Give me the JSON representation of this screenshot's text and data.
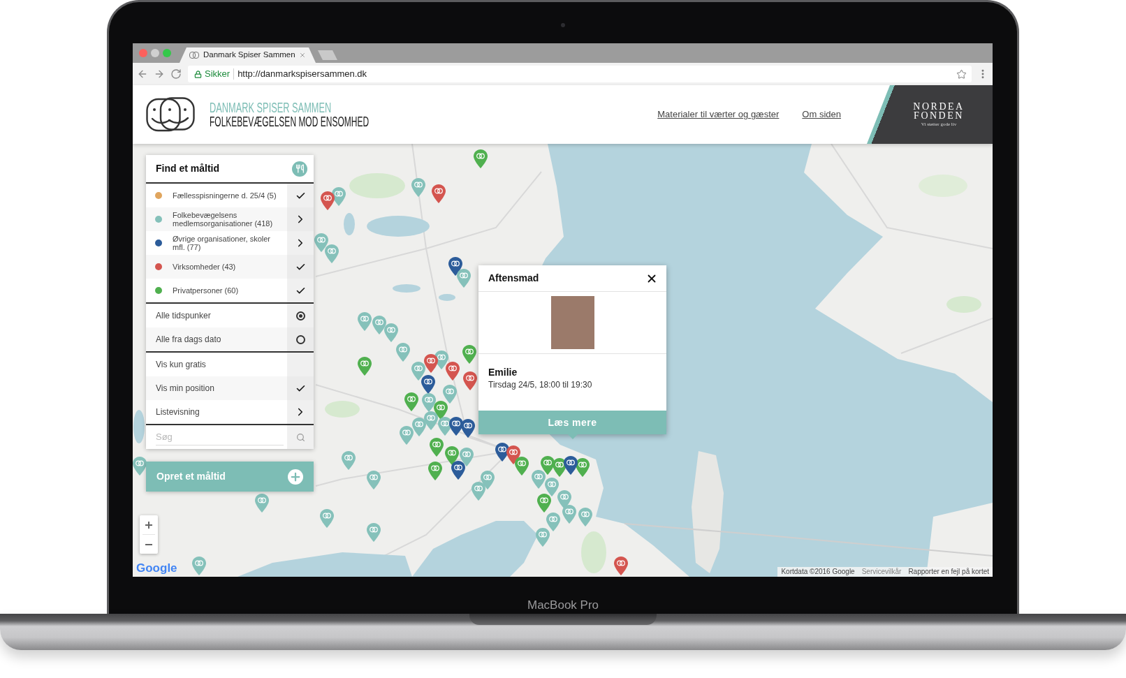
{
  "device": {
    "label": "MacBook Pro"
  },
  "browser": {
    "tab": {
      "title": "Danmark Spiser Sammen"
    },
    "address_bar": {
      "security_label": "Sikker",
      "url": "http://danmarkspisersammen.dk"
    }
  },
  "header": {
    "title": "DANMARK SPISER SAMMEN",
    "subtitle": "FOLKEBEVÆGELSEN MOD ENSOMHED",
    "links": [
      {
        "label": "Materialer til værter og gæster"
      },
      {
        "label": "Om siden"
      }
    ],
    "sponsor": {
      "line_1": "NORDEA",
      "line_2": "FONDEN",
      "tagline": "Vi støtter gode liv"
    }
  },
  "filter_panel": {
    "title": "Find et måltid",
    "categories": [
      {
        "label": "Fællesspisningerne d. 25/4 (5)",
        "color": "#e0a55e",
        "kind": "checkbox",
        "checked": true
      },
      {
        "label": "Folkebevægelsens medlemsorganisationer (418)",
        "color": "#85c1ba",
        "kind": "submenu"
      },
      {
        "label": "Øvrige organisationer, skoler mfl. (77)",
        "color": "#2c5c9a",
        "kind": "submenu"
      },
      {
        "label": "Virksomheder (43)",
        "color": "#d4554f",
        "kind": "checkbox",
        "checked": true
      },
      {
        "label": "Privatpersoner (60)",
        "color": "#50b04f",
        "kind": "checkbox",
        "checked": true
      }
    ],
    "time_options": [
      {
        "label": "Alle tidspunker",
        "selected": true
      },
      {
        "label": "Alle fra dags dato",
        "selected": false
      }
    ],
    "options": [
      {
        "label": "Vis kun gratis",
        "kind": "checkbox",
        "checked": false
      },
      {
        "label": "Vis min position",
        "kind": "checkbox",
        "checked": true
      },
      {
        "label": "Listevisning",
        "kind": "submenu"
      }
    ],
    "search": {
      "placeholder": "Søg"
    }
  },
  "create_button": {
    "label": "Opret et måltid"
  },
  "popup": {
    "title": "Aftensmad",
    "host": "Emilie",
    "time": "Tirsdag 24/5, 18:00 til 19:30",
    "button": "Læs mere"
  },
  "map": {
    "logo": "Google",
    "attribution": [
      {
        "label": "Kortdata ©2016 Google"
      },
      {
        "label": "Servicevilkår"
      },
      {
        "label": "Rapporter en fejl på kortet"
      }
    ],
    "markers": [
      {
        "color": "#50b04f"
      },
      {
        "color": "#85c1ba"
      },
      {
        "color": "#d4554f"
      },
      {
        "color": "#85c1ba"
      },
      {
        "color": "#d4554f"
      },
      {
        "color": "#85c1ba"
      },
      {
        "color": "#85c1ba"
      },
      {
        "color": "#2c5c9a"
      },
      {
        "color": "#85c1ba"
      },
      {
        "color": "#85c1ba"
      },
      {
        "color": "#85c1ba"
      },
      {
        "color": "#85c1ba"
      },
      {
        "color": "#50b04f"
      },
      {
        "color": "#85c1ba"
      },
      {
        "color": "#85c1ba"
      },
      {
        "color": "#d4554f"
      },
      {
        "color": "#d4554f"
      },
      {
        "color": "#85c1ba"
      },
      {
        "color": "#50b04f"
      },
      {
        "color": "#2c5c9a"
      },
      {
        "color": "#85c1ba"
      },
      {
        "color": "#d4554f"
      },
      {
        "color": "#50b04f"
      },
      {
        "color": "#85c1ba"
      },
      {
        "color": "#50b04f"
      },
      {
        "color": "#85c1ba"
      },
      {
        "color": "#85c1ba"
      },
      {
        "color": "#85c1ba"
      },
      {
        "color": "#85c1ba"
      },
      {
        "color": "#2c5c9a"
      },
      {
        "color": "#2c5c9a"
      },
      {
        "color": "#50b04f"
      },
      {
        "color": "#50b04f"
      },
      {
        "color": "#85c1ba"
      },
      {
        "color": "#2c5c9a"
      },
      {
        "color": "#50b04f"
      },
      {
        "color": "#2c5c9a"
      },
      {
        "color": "#d4554f"
      },
      {
        "color": "#50b04f"
      },
      {
        "color": "#50b04f"
      },
      {
        "color": "#50b04f"
      },
      {
        "color": "#50b04f"
      },
      {
        "color": "#2c5c9a"
      },
      {
        "color": "#85c1ba"
      },
      {
        "color": "#85c1ba"
      },
      {
        "color": "#50b04f"
      },
      {
        "color": "#85c1ba"
      },
      {
        "color": "#85c1ba"
      },
      {
        "color": "#85c1ba"
      },
      {
        "color": "#85c1ba"
      },
      {
        "color": "#85c1ba"
      },
      {
        "color": "#85c1ba"
      },
      {
        "color": "#85c1ba"
      },
      {
        "color": "#85c1ba"
      },
      {
        "color": "#85c1ba"
      },
      {
        "color": "#85c1ba"
      },
      {
        "color": "#85c1ba"
      },
      {
        "color": "#85c1ba"
      },
      {
        "color": "#85c1ba"
      },
      {
        "color": "#85c1ba"
      },
      {
        "color": "#d4554f"
      }
    ]
  }
}
